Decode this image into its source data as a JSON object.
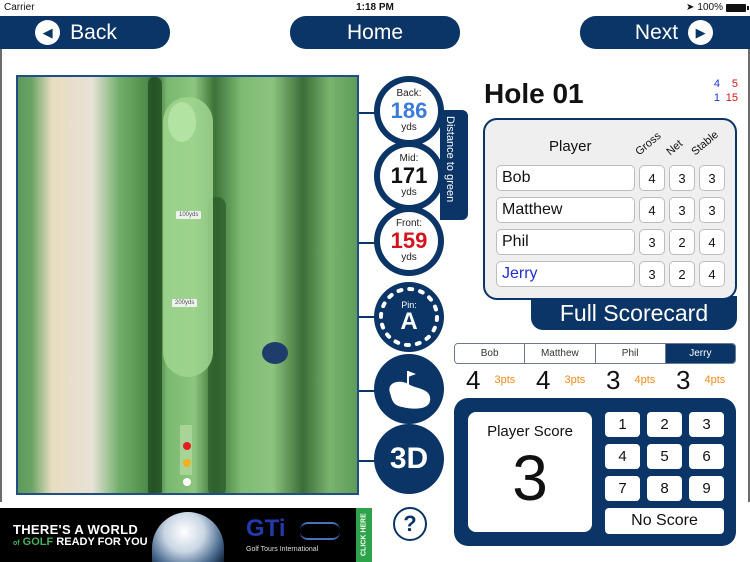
{
  "status_bar": {
    "carrier": "Carrier",
    "time": "1:18 PM",
    "battery": "100%"
  },
  "nav": {
    "back": "Back",
    "home": "Home",
    "next": "Next"
  },
  "map": {
    "markers": [
      "100yds",
      "200yds"
    ],
    "tee_colors": [
      "#e02020",
      "#f0b020",
      "#ffffff"
    ]
  },
  "distance": {
    "tab_label": "Distance to green",
    "back": {
      "label": "Back:",
      "value": "186",
      "unit": "yds",
      "color": "#3b7bd8"
    },
    "mid": {
      "label": "Mid:",
      "value": "171",
      "unit": "yds",
      "color": "#111111"
    },
    "front": {
      "label": "Front:",
      "value": "159",
      "unit": "yds",
      "color": "#d4141c"
    }
  },
  "pin": {
    "label": "Pin:",
    "value": "A"
  },
  "view_3d": "3D",
  "help": "?",
  "hole": {
    "title": "Hole 01",
    "par_si": {
      "blue_par": "4",
      "red_par": "5",
      "blue_si": "1",
      "red_si": "15"
    }
  },
  "scorecard": {
    "headers": {
      "player": "Player",
      "gross": "Gross",
      "net": "Net",
      "stable": "Stable"
    },
    "rows": [
      {
        "name": "Bob",
        "gross": "4",
        "net": "3",
        "stable": "3",
        "selected": false
      },
      {
        "name": "Matthew",
        "gross": "4",
        "net": "3",
        "stable": "3",
        "selected": false
      },
      {
        "name": "Phil",
        "gross": "3",
        "net": "2",
        "stable": "4",
        "selected": false
      },
      {
        "name": "Jerry",
        "gross": "3",
        "net": "2",
        "stable": "4",
        "selected": true
      }
    ],
    "full_label": "Full Scorecard"
  },
  "player_tabs": [
    {
      "label": "Bob",
      "active": false
    },
    {
      "label": "Matthew",
      "active": false
    },
    {
      "label": "Phil",
      "active": false
    },
    {
      "label": "Jerry",
      "active": true
    }
  ],
  "quick_scores": [
    {
      "gross": "4",
      "pts": "3pts"
    },
    {
      "gross": "4",
      "pts": "3pts"
    },
    {
      "gross": "3",
      "pts": "4pts"
    },
    {
      "gross": "3",
      "pts": "4pts"
    }
  ],
  "keypad": {
    "title": "Player Score",
    "value": "3",
    "keys": [
      "1",
      "2",
      "3",
      "4",
      "5",
      "6",
      "7",
      "8",
      "9"
    ],
    "no_score": "No Score"
  },
  "ad": {
    "line1": "THERE'S A WORLD",
    "line2_prefix": "of",
    "line2_green": "GOLF",
    "line2_rest": "READY FOR YOU",
    "brand": "GTi",
    "brand_sub": "Golf Tours International",
    "cta": "CLICK HERE"
  },
  "colors": {
    "navy": "#0b3566",
    "orange": "#f08c1a",
    "selected_blue": "#1f2fcf"
  }
}
